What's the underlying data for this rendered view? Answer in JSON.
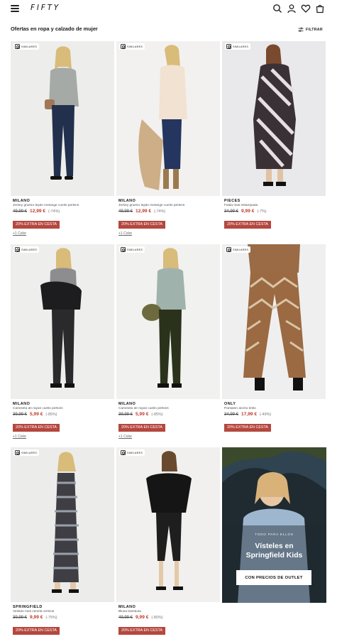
{
  "header": {
    "logo": "FIFTY",
    "icons": [
      "menu-icon",
      "search-icon",
      "user-icon",
      "heart-icon",
      "bag-icon"
    ]
  },
  "page": {
    "title": "Ofertas en ropa y calzado de mujer",
    "filter_label": "FILTRAR"
  },
  "similar_label": "SIMILARES",
  "products": [
    {
      "brand": "MILANO",
      "name": "Jersey grueso tejido melange cuello perkins",
      "old_price": "49,99 €",
      "price": "12,99 €",
      "discount": "(-74%)",
      "promo": "20% EXTRA EN CESTA",
      "colors": "+1 Color"
    },
    {
      "brand": "MILANO",
      "name": "Jersey grueso tejido melange cuello perkins",
      "old_price": "49,99 €",
      "price": "12,99 €",
      "discount": "(-74%)",
      "promo": "20% EXTRA EN CESTA",
      "colors": "+1 Color"
    },
    {
      "brand": "PIECES",
      "name": "Falda midi estampada",
      "old_price": "34,99 €",
      "price": "9,99 €",
      "discount": "(-7%)",
      "promo": "20% EXTRA EN CESTA",
      "colors": ""
    },
    {
      "brand": "MILANO",
      "name": "Camiseta de rayas cuello perkins",
      "old_price": "39,99 €",
      "price": "5,99 €",
      "discount": "(-85%)",
      "promo": "20% EXTRA EN CESTA",
      "colors": "+1 Color"
    },
    {
      "brand": "MILANO",
      "name": "Camiseta de rayas cuello perkins",
      "old_price": "39,99 €",
      "price": "5,99 €",
      "discount": "(-85%)",
      "promo": "20% EXTRA EN CESTA",
      "colors": "+1 Color"
    },
    {
      "brand": "ONLY",
      "name": "Pantalón ancho brillo",
      "old_price": "34,99 €",
      "price": "17,99 €",
      "discount": "(-49%)",
      "promo": "20% EXTRA EN CESTA",
      "colors": ""
    },
    {
      "brand": "SPRINGFIELD",
      "name": "Vestido midi cenefa vertical",
      "old_price": "39,99 €",
      "price": "9,99 €",
      "discount": "(-75%)",
      "promo": "20% EXTRA EN CESTA",
      "colors": ""
    },
    {
      "brand": "MILANO",
      "name": "Blusa bambula",
      "old_price": "49,99 €",
      "price": "9,99 €",
      "discount": "(-80%)",
      "promo": "20% EXTRA EN CESTA",
      "colors": ""
    }
  ],
  "promo": {
    "kicker": "TODO PARA ELLOS",
    "headline_1": "Vísteles en",
    "headline_2": "Springfield Kids",
    "cta": "CON PRECIOS DE OUTLET"
  },
  "colors": {
    "sale_price": "#c0392b",
    "tag_bg": "#b5473e"
  }
}
